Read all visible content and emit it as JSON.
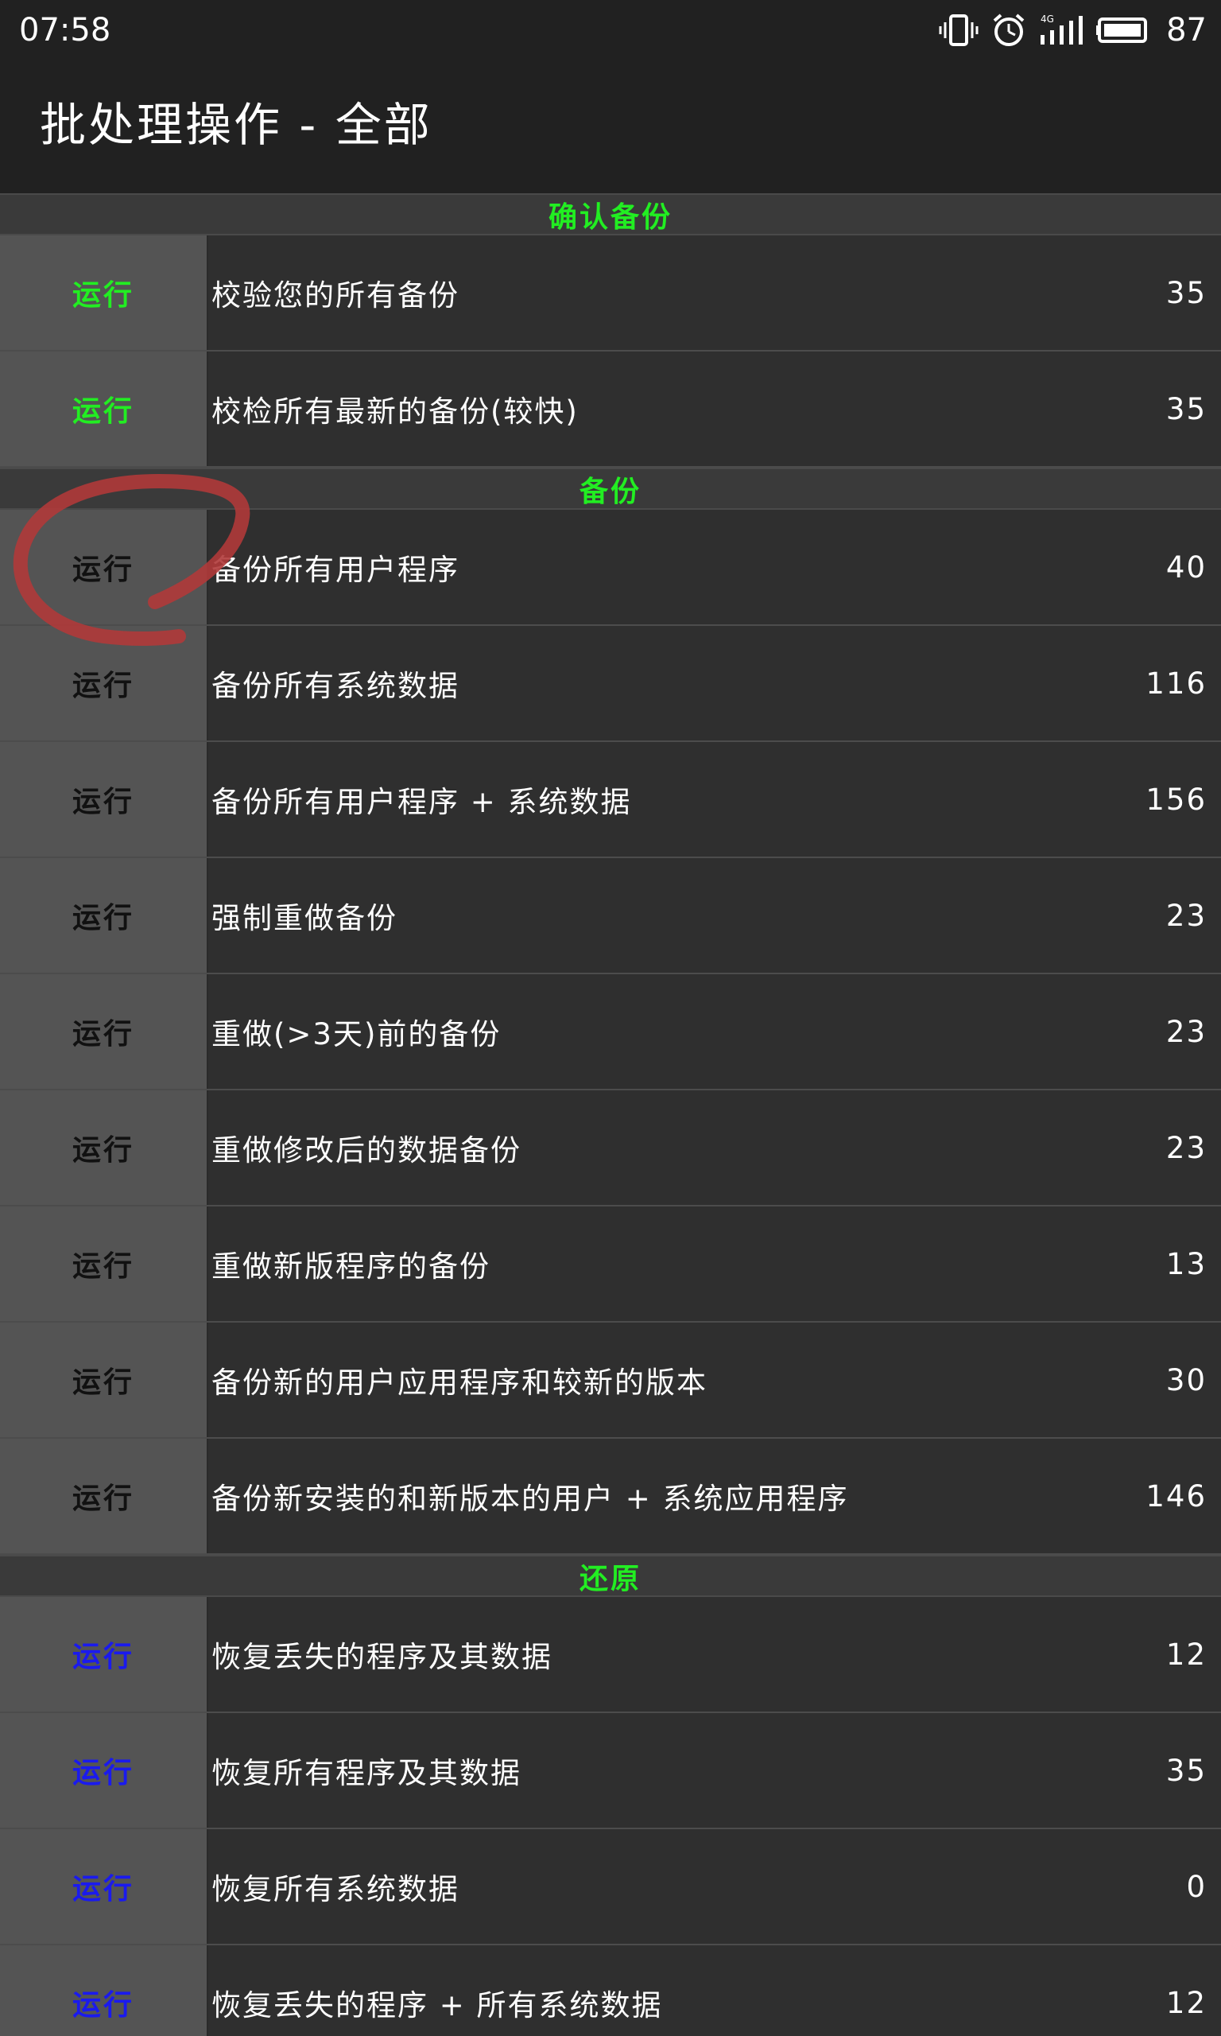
{
  "status_bar": {
    "time": "07:58",
    "network_label": "4G",
    "battery_level": "87",
    "icons": [
      "vibrate-icon",
      "alarm-icon",
      "signal-icon",
      "battery-icon"
    ]
  },
  "app_bar": {
    "title": "批处理操作 - 全部"
  },
  "colors": {
    "section_header_text": "#22ee22",
    "run_verify": "#22ee22",
    "run_backup": "#111111",
    "run_restore": "#1a1aee",
    "annotation_circle": "#b03a3a"
  },
  "sections": [
    {
      "title": "确认备份",
      "rows": [
        {
          "run": "运行",
          "label": "校验您的所有备份",
          "count": "35"
        },
        {
          "run": "运行",
          "label": "校检所有最新的备份(较快)",
          "count": "35"
        }
      ]
    },
    {
      "title": "备份",
      "rows": [
        {
          "run": "运行",
          "label": "备份所有用户程序",
          "count": "40"
        },
        {
          "run": "运行",
          "label": "备份所有系统数据",
          "count": "116"
        },
        {
          "run": "运行",
          "label": "备份所有用户程序 + 系统数据",
          "count": "156"
        },
        {
          "run": "运行",
          "label": "强制重做备份",
          "count": "23"
        },
        {
          "run": "运行",
          "label": "重做(>3天)前的备份",
          "count": "23"
        },
        {
          "run": "运行",
          "label": "重做修改后的数据备份",
          "count": "23"
        },
        {
          "run": "运行",
          "label": "重做新版程序的备份",
          "count": "13"
        },
        {
          "run": "运行",
          "label": "备份新的用户应用程序和较新的版本",
          "count": "30"
        },
        {
          "run": "运行",
          "label": "备份新安装的和新版本的用户 + 系统应用程序",
          "count": "146"
        }
      ]
    },
    {
      "title": "还原",
      "rows": [
        {
          "run": "运行",
          "label": "恢复丢失的程序及其数据",
          "count": "12"
        },
        {
          "run": "运行",
          "label": "恢复所有程序及其数据",
          "count": "35"
        },
        {
          "run": "运行",
          "label": "恢复所有系统数据",
          "count": "0"
        },
        {
          "run": "运行",
          "label": "恢复丢失的程序 + 所有系统数据",
          "count": "12"
        }
      ]
    }
  ]
}
